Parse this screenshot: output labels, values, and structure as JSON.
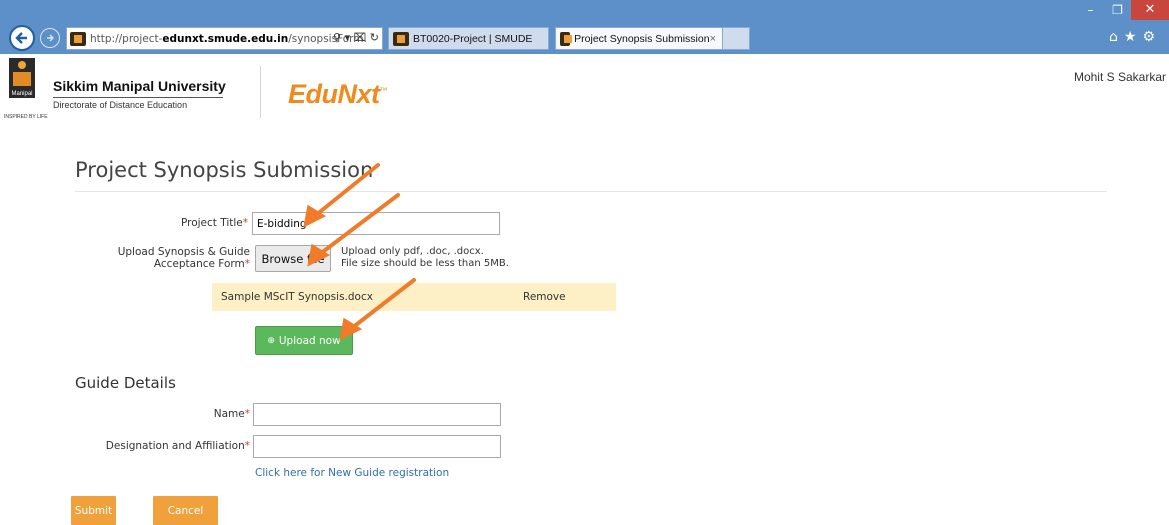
{
  "browser": {
    "window_controls": {
      "minimize": "–",
      "restore": "❐",
      "close": "✕"
    },
    "address": {
      "prefix": "http://project-",
      "domain": "edunxt.smude.edu.in",
      "path": "/synopsisForm.",
      "tools": "⚲ ▾ ⌧ ↻"
    },
    "tabs": [
      {
        "label": "BT0020-Project | SMUDE"
      },
      {
        "label": "Project Synopsis Submission",
        "close": "×"
      }
    ],
    "toolbar_icons": "⌂★⚙"
  },
  "header": {
    "logo_mark_text": "Manipal",
    "logo_tagline": "INSPIRED BY LIFE",
    "university_name": "Sikkim Manipal University",
    "university_sub": "Directorate of Distance Education",
    "product_name": "EduNxt",
    "product_tm": "™",
    "user_name": "Mohit S Sakarkar"
  },
  "form": {
    "page_title": "Project Synopsis Submission",
    "required_mark": "*",
    "project_title_label": "Project Title",
    "project_title_value": "E-bidding",
    "upload_label_line1": "Upload Synopsis & Guide",
    "upload_label_line2": "Acceptance Form",
    "browse_label": "Browse file",
    "hint_line1": "Upload only pdf, .doc, .docx.",
    "hint_line2": "File size should be less than 5MB.",
    "selected_file_name": "Sample MScIT Synopsis.docx",
    "remove_label": "Remove",
    "upload_button_icon": "⊕",
    "upload_button_label": "Upload now"
  },
  "guide": {
    "section_title": "Guide Details",
    "name_label": "Name",
    "name_value": "",
    "designation_label": "Designation and Affiliation",
    "designation_value": "",
    "register_link": "Click here for New Guide registration"
  },
  "actions": {
    "submit_label": "Submit",
    "cancel_label": "Cancel"
  },
  "colors": {
    "chrome_blue": "#5d8fc9",
    "brand_orange": "#f08a1c",
    "upload_green": "#5cb85c",
    "file_row_bg": "#fdf0c6",
    "annotation_arrow": "#f07b2a",
    "required_red": "#d23c2e"
  }
}
